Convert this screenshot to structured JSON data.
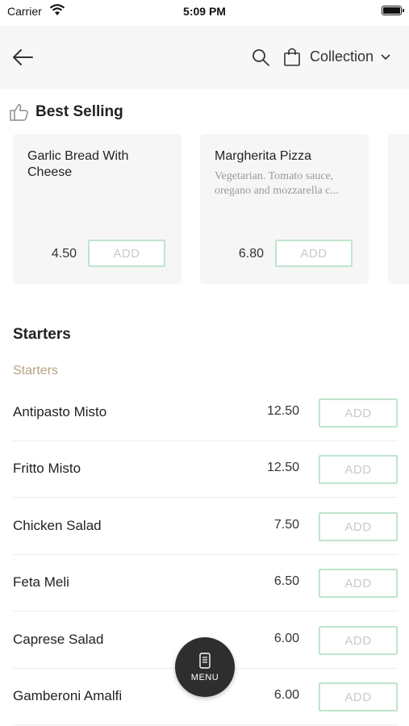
{
  "status_bar": {
    "carrier": "Carrier",
    "time": "5:09 PM"
  },
  "header": {
    "collection_label": "Collection"
  },
  "best_selling": {
    "title": "Best Selling",
    "items": [
      {
        "name": "Garlic Bread With Cheese",
        "description": "",
        "price": "4.50",
        "add_label": "ADD"
      },
      {
        "name": "Margherita Pizza",
        "description": "Vegetarian. Tomato sauce, oregano and mozzarella c...",
        "price": "6.80",
        "add_label": "ADD"
      }
    ]
  },
  "starters": {
    "title": "Starters",
    "subtitle": "Starters",
    "items": [
      {
        "name": "Antipasto Misto",
        "price": "12.50",
        "add_label": "ADD"
      },
      {
        "name": "Fritto Misto",
        "price": "12.50",
        "add_label": "ADD"
      },
      {
        "name": "Chicken Salad",
        "price": "7.50",
        "add_label": "ADD"
      },
      {
        "name": "Feta Meli",
        "price": "6.50",
        "add_label": "ADD"
      },
      {
        "name": "Caprese Salad",
        "price": "6.00",
        "add_label": "ADD"
      },
      {
        "name": "Gamberoni Amalfi",
        "price": "6.00",
        "add_label": "ADD"
      }
    ]
  },
  "menu_fab": {
    "label": "MENU"
  },
  "icons": [
    "wifi-icon",
    "battery-icon",
    "back-arrow-icon",
    "search-icon",
    "shopping-bag-icon",
    "chevron-down-icon",
    "thumbs-up-icon",
    "menu-phone-icon"
  ],
  "colors": {
    "add_border": "#bfe4cd",
    "subtitle": "#b8a37f",
    "fab": "#2e2e2e",
    "header_bg": "#f7f7f7",
    "card_bg": "#f6f6f6"
  }
}
